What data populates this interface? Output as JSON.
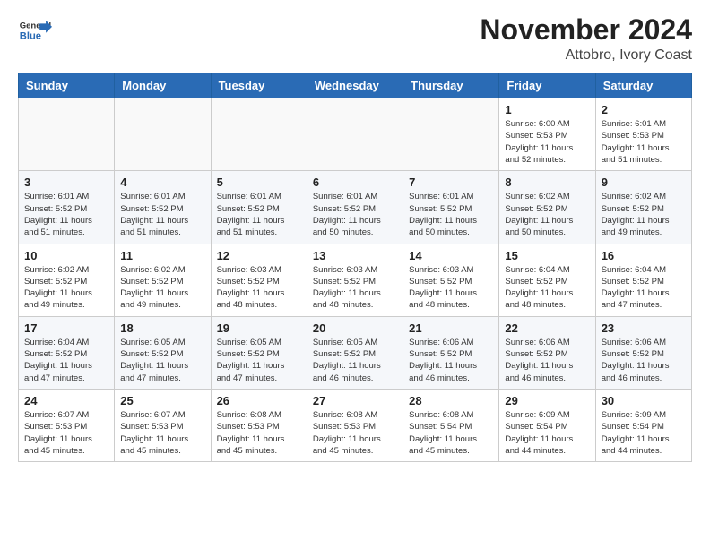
{
  "header": {
    "title": "November 2024",
    "subtitle": "Attobro, Ivory Coast"
  },
  "logo": {
    "line1": "General",
    "line2": "Blue"
  },
  "weekdays": [
    "Sunday",
    "Monday",
    "Tuesday",
    "Wednesday",
    "Thursday",
    "Friday",
    "Saturday"
  ],
  "weeks": [
    [
      {
        "day": "",
        "info": ""
      },
      {
        "day": "",
        "info": ""
      },
      {
        "day": "",
        "info": ""
      },
      {
        "day": "",
        "info": ""
      },
      {
        "day": "",
        "info": ""
      },
      {
        "day": "1",
        "info": "Sunrise: 6:00 AM\nSunset: 5:53 PM\nDaylight: 11 hours\nand 52 minutes."
      },
      {
        "day": "2",
        "info": "Sunrise: 6:01 AM\nSunset: 5:53 PM\nDaylight: 11 hours\nand 51 minutes."
      }
    ],
    [
      {
        "day": "3",
        "info": "Sunrise: 6:01 AM\nSunset: 5:52 PM\nDaylight: 11 hours\nand 51 minutes."
      },
      {
        "day": "4",
        "info": "Sunrise: 6:01 AM\nSunset: 5:52 PM\nDaylight: 11 hours\nand 51 minutes."
      },
      {
        "day": "5",
        "info": "Sunrise: 6:01 AM\nSunset: 5:52 PM\nDaylight: 11 hours\nand 51 minutes."
      },
      {
        "day": "6",
        "info": "Sunrise: 6:01 AM\nSunset: 5:52 PM\nDaylight: 11 hours\nand 50 minutes."
      },
      {
        "day": "7",
        "info": "Sunrise: 6:01 AM\nSunset: 5:52 PM\nDaylight: 11 hours\nand 50 minutes."
      },
      {
        "day": "8",
        "info": "Sunrise: 6:02 AM\nSunset: 5:52 PM\nDaylight: 11 hours\nand 50 minutes."
      },
      {
        "day": "9",
        "info": "Sunrise: 6:02 AM\nSunset: 5:52 PM\nDaylight: 11 hours\nand 49 minutes."
      }
    ],
    [
      {
        "day": "10",
        "info": "Sunrise: 6:02 AM\nSunset: 5:52 PM\nDaylight: 11 hours\nand 49 minutes."
      },
      {
        "day": "11",
        "info": "Sunrise: 6:02 AM\nSunset: 5:52 PM\nDaylight: 11 hours\nand 49 minutes."
      },
      {
        "day": "12",
        "info": "Sunrise: 6:03 AM\nSunset: 5:52 PM\nDaylight: 11 hours\nand 48 minutes."
      },
      {
        "day": "13",
        "info": "Sunrise: 6:03 AM\nSunset: 5:52 PM\nDaylight: 11 hours\nand 48 minutes."
      },
      {
        "day": "14",
        "info": "Sunrise: 6:03 AM\nSunset: 5:52 PM\nDaylight: 11 hours\nand 48 minutes."
      },
      {
        "day": "15",
        "info": "Sunrise: 6:04 AM\nSunset: 5:52 PM\nDaylight: 11 hours\nand 48 minutes."
      },
      {
        "day": "16",
        "info": "Sunrise: 6:04 AM\nSunset: 5:52 PM\nDaylight: 11 hours\nand 47 minutes."
      }
    ],
    [
      {
        "day": "17",
        "info": "Sunrise: 6:04 AM\nSunset: 5:52 PM\nDaylight: 11 hours\nand 47 minutes."
      },
      {
        "day": "18",
        "info": "Sunrise: 6:05 AM\nSunset: 5:52 PM\nDaylight: 11 hours\nand 47 minutes."
      },
      {
        "day": "19",
        "info": "Sunrise: 6:05 AM\nSunset: 5:52 PM\nDaylight: 11 hours\nand 47 minutes."
      },
      {
        "day": "20",
        "info": "Sunrise: 6:05 AM\nSunset: 5:52 PM\nDaylight: 11 hours\nand 46 minutes."
      },
      {
        "day": "21",
        "info": "Sunrise: 6:06 AM\nSunset: 5:52 PM\nDaylight: 11 hours\nand 46 minutes."
      },
      {
        "day": "22",
        "info": "Sunrise: 6:06 AM\nSunset: 5:52 PM\nDaylight: 11 hours\nand 46 minutes."
      },
      {
        "day": "23",
        "info": "Sunrise: 6:06 AM\nSunset: 5:52 PM\nDaylight: 11 hours\nand 46 minutes."
      }
    ],
    [
      {
        "day": "24",
        "info": "Sunrise: 6:07 AM\nSunset: 5:53 PM\nDaylight: 11 hours\nand 45 minutes."
      },
      {
        "day": "25",
        "info": "Sunrise: 6:07 AM\nSunset: 5:53 PM\nDaylight: 11 hours\nand 45 minutes."
      },
      {
        "day": "26",
        "info": "Sunrise: 6:08 AM\nSunset: 5:53 PM\nDaylight: 11 hours\nand 45 minutes."
      },
      {
        "day": "27",
        "info": "Sunrise: 6:08 AM\nSunset: 5:53 PM\nDaylight: 11 hours\nand 45 minutes."
      },
      {
        "day": "28",
        "info": "Sunrise: 6:08 AM\nSunset: 5:54 PM\nDaylight: 11 hours\nand 45 minutes."
      },
      {
        "day": "29",
        "info": "Sunrise: 6:09 AM\nSunset: 5:54 PM\nDaylight: 11 hours\nand 44 minutes."
      },
      {
        "day": "30",
        "info": "Sunrise: 6:09 AM\nSunset: 5:54 PM\nDaylight: 11 hours\nand 44 minutes."
      }
    ]
  ]
}
